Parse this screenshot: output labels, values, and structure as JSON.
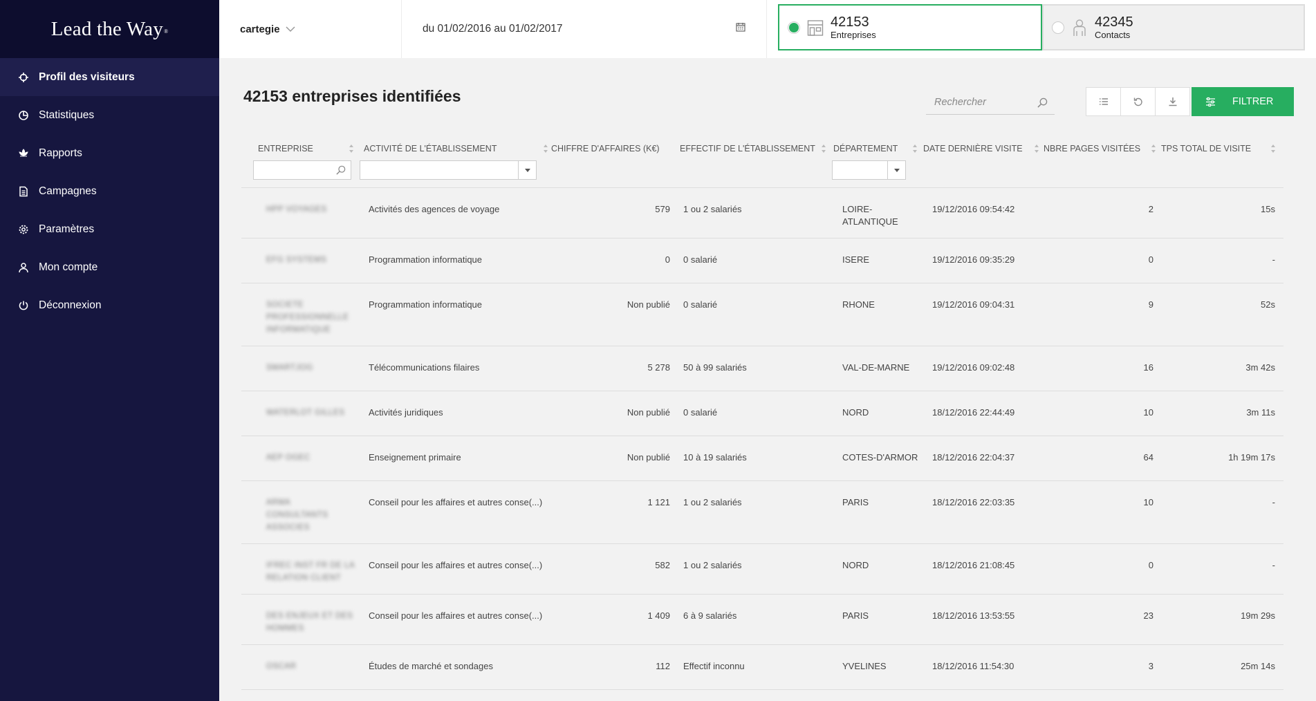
{
  "app": {
    "logo": "Lead the Way",
    "logo_mark": "®"
  },
  "sidebar": {
    "items": [
      {
        "label": "Profil des visiteurs",
        "icon": "crosshair-icon",
        "active": true
      },
      {
        "label": "Statistiques",
        "icon": "pie-chart-icon"
      },
      {
        "label": "Rapports",
        "icon": "lotus-icon"
      },
      {
        "label": "Campagnes",
        "icon": "document-icon"
      },
      {
        "label": "Paramètres",
        "icon": "gear-icon"
      },
      {
        "label": "Mon compte",
        "icon": "user-icon"
      },
      {
        "label": "Déconnexion",
        "icon": "power-icon"
      }
    ]
  },
  "topbar": {
    "account": "cartegie",
    "date_range": "du 01/02/2016 au 01/02/2017",
    "counters": [
      {
        "value": "42153",
        "label": "Entreprises",
        "selected": true
      },
      {
        "value": "42345",
        "label": "Contacts",
        "selected": false
      }
    ]
  },
  "main": {
    "title_count": "42153",
    "title_bold": "entreprises",
    "title_rest": "identifiées",
    "search_placeholder": "Rechercher",
    "filter_label": "FILTRER",
    "accent": "#27ae60"
  },
  "table": {
    "columns": [
      "ENTREPRISE",
      "ACTIVITÉ DE L'ÉTABLISSEMENT",
      "CHIFFRE D'AFFAIRES (K€)",
      "EFFECTIF DE L'ÉTABLISSEMENT",
      "DÉPARTEMENT",
      "DATE DERNIÈRE VISITE",
      "NBRE PAGES VISITÉES",
      "TPS TOTAL DE VISITE"
    ],
    "rows": [
      {
        "entreprise": "HPP VOYAGES",
        "activite": "Activités des agences de voyage",
        "ca": "579",
        "effectif": "1 ou 2 salariés",
        "dept": "LOIRE-ATLANTIQUE",
        "date": "19/12/2016 09:54:42",
        "pages": "2",
        "tps": "15s"
      },
      {
        "entreprise": "EFG SYSTEMS",
        "activite": "Programmation informatique",
        "ca": "0",
        "effectif": "0 salarié",
        "dept": "ISERE",
        "date": "19/12/2016 09:35:29",
        "pages": "0",
        "tps": "-"
      },
      {
        "entreprise": "SOCIETE PROFESSIONNELLE INFORMATIQUE",
        "activite": "Programmation informatique",
        "ca": "Non publié",
        "effectif": "0 salarié",
        "dept": "RHONE",
        "date": "19/12/2016 09:04:31",
        "pages": "9",
        "tps": "52s"
      },
      {
        "entreprise": "SMARTJOG",
        "activite": "Télécommunications filaires",
        "ca": "5 278",
        "effectif": "50 à 99 salariés",
        "dept": "VAL-DE-MARNE",
        "date": "19/12/2016 09:02:48",
        "pages": "16",
        "tps": "3m 42s"
      },
      {
        "entreprise": "WATERLOT GILLES",
        "activite": "Activités juridiques",
        "ca": "Non publié",
        "effectif": "0 salarié",
        "dept": "NORD",
        "date": "18/12/2016 22:44:49",
        "pages": "10",
        "tps": "3m 11s"
      },
      {
        "entreprise": "AEP OGEC",
        "activite": "Enseignement primaire",
        "ca": "Non publié",
        "effectif": "10 à 19 salariés",
        "dept": "COTES-D'ARMOR",
        "date": "18/12/2016 22:04:37",
        "pages": "64",
        "tps": "1h 19m 17s"
      },
      {
        "entreprise": "ARMA CONSULTANTS ASSOCIES",
        "activite": "Conseil pour les affaires et autres conse(...)",
        "ca": "1 121",
        "effectif": "1 ou 2 salariés",
        "dept": "PARIS",
        "date": "18/12/2016 22:03:35",
        "pages": "10",
        "tps": "-"
      },
      {
        "entreprise": "IFREC INST FR DE LA RELATION CLIENT",
        "activite": "Conseil pour les affaires et autres conse(...)",
        "ca": "582",
        "effectif": "1 ou 2 salariés",
        "dept": "NORD",
        "date": "18/12/2016 21:08:45",
        "pages": "0",
        "tps": "-"
      },
      {
        "entreprise": "DES ENJEUX ET DES HOMMES",
        "activite": "Conseil pour les affaires et autres conse(...)",
        "ca": "1 409",
        "effectif": "6 à 9 salariés",
        "dept": "PARIS",
        "date": "18/12/2016 13:53:55",
        "pages": "23",
        "tps": "19m 29s"
      },
      {
        "entreprise": "OSCAR",
        "activite": "Études de marché et sondages",
        "ca": "112",
        "effectif": "Effectif inconnu",
        "dept": "YVELINES",
        "date": "18/12/2016 11:54:30",
        "pages": "3",
        "tps": "25m 14s"
      }
    ]
  }
}
